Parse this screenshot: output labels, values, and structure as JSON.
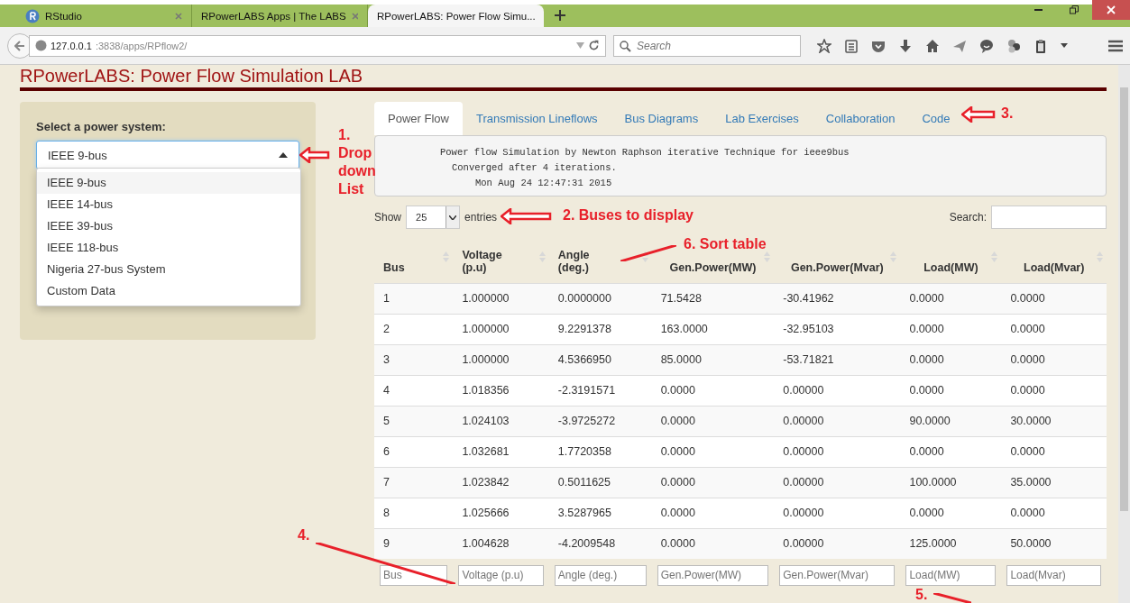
{
  "browser": {
    "tabs": [
      {
        "title": "RStudio",
        "selected": false,
        "kind": "rlogo"
      },
      {
        "title": "RPowerLABS Apps | The LABS",
        "selected": false,
        "kind": "plain"
      },
      {
        "title": "RPowerLABS: Power Flow Simu...",
        "selected": true,
        "kind": "plain"
      }
    ],
    "url": {
      "host": "127.0.0.1",
      "path": ":3838/apps/RPflow2/"
    },
    "search": {
      "placeholder": "Search"
    }
  },
  "page_title": "RPowerLABS: Power Flow Simulation LAB",
  "sidebar": {
    "label": "Select a power system:",
    "select": {
      "value": "IEEE 9-bus",
      "expanded": true
    },
    "options": [
      {
        "label": "IEEE 9-bus",
        "selected": true
      },
      {
        "label": "IEEE 14-bus",
        "selected": false
      },
      {
        "label": "IEEE 39-bus",
        "selected": false
      },
      {
        "label": "IEEE 118-bus",
        "selected": false
      },
      {
        "label": "Nigeria 27-bus System",
        "selected": false
      },
      {
        "label": "Custom Data",
        "selected": false
      }
    ]
  },
  "tabs": [
    {
      "label": "Power Flow",
      "selected": true
    },
    {
      "label": "Transmission Lineflows",
      "selected": false
    },
    {
      "label": "Bus Diagrams",
      "selected": false
    },
    {
      "label": "Lab Exercises",
      "selected": false
    },
    {
      "label": "Collaboration",
      "selected": false
    },
    {
      "label": "Code",
      "selected": false
    }
  ],
  "console": [
    "Power flow Simulation by Newton Raphson iterative Technique for ieee9bus",
    "Converged after 4 iterations.",
    "Mon Aug 24 12:47:31 2015"
  ],
  "length_control": {
    "show": "Show",
    "value": "25",
    "entries": "entries"
  },
  "search_label": "Search:",
  "table": {
    "columns": [
      "Bus",
      "Voltage (p.u)",
      "Angle (deg.)",
      "Gen.Power(MW)",
      "Gen.Power(Mvar)",
      "Load(MW)",
      "Load(Mvar)"
    ],
    "rows": [
      [
        "1",
        "1.000000",
        "0.0000000",
        "71.5428",
        "-30.41962",
        "0.0000",
        "0.0000"
      ],
      [
        "2",
        "1.000000",
        "9.2291378",
        "163.0000",
        "-32.95103",
        "0.0000",
        "0.0000"
      ],
      [
        "3",
        "1.000000",
        "4.5366950",
        "85.0000",
        "-53.71821",
        "0.0000",
        "0.0000"
      ],
      [
        "4",
        "1.018356",
        "-2.3191571",
        "0.0000",
        "0.00000",
        "0.0000",
        "0.0000"
      ],
      [
        "5",
        "1.024103",
        "-3.9725272",
        "0.0000",
        "0.00000",
        "90.0000",
        "30.0000"
      ],
      [
        "6",
        "1.032681",
        "1.7720358",
        "0.0000",
        "0.00000",
        "0.0000",
        "0.0000"
      ],
      [
        "7",
        "1.023842",
        "0.5011625",
        "0.0000",
        "0.00000",
        "100.0000",
        "35.0000"
      ],
      [
        "8",
        "1.025666",
        "3.5287965",
        "0.0000",
        "0.00000",
        "0.0000",
        "0.0000"
      ],
      [
        "9",
        "1.004628",
        "-4.2009548",
        "0.0000",
        "0.00000",
        "125.0000",
        "50.0000"
      ]
    ],
    "filters": [
      {
        "placeholder": "Bus"
      },
      {
        "placeholder": "Voltage (p.u)"
      },
      {
        "placeholder": "Angle (deg.)"
      },
      {
        "placeholder": "Gen.Power(MW)"
      },
      {
        "placeholder": "Gen.Power(Mvar)"
      },
      {
        "placeholder": "Load(MW)"
      },
      {
        "placeholder": "Load(Mvar)"
      }
    ]
  },
  "annotations": [
    {
      "text": "1. Drop down List",
      "kind": "arrow"
    },
    {
      "text": "2. Buses to display",
      "kind": "arrow"
    },
    {
      "text": "3.",
      "kind": "arrow"
    },
    {
      "text": "4.",
      "kind": "line"
    },
    {
      "text": "5.",
      "kind": "line"
    },
    {
      "text": "6. Sort table",
      "kind": "line"
    }
  ]
}
